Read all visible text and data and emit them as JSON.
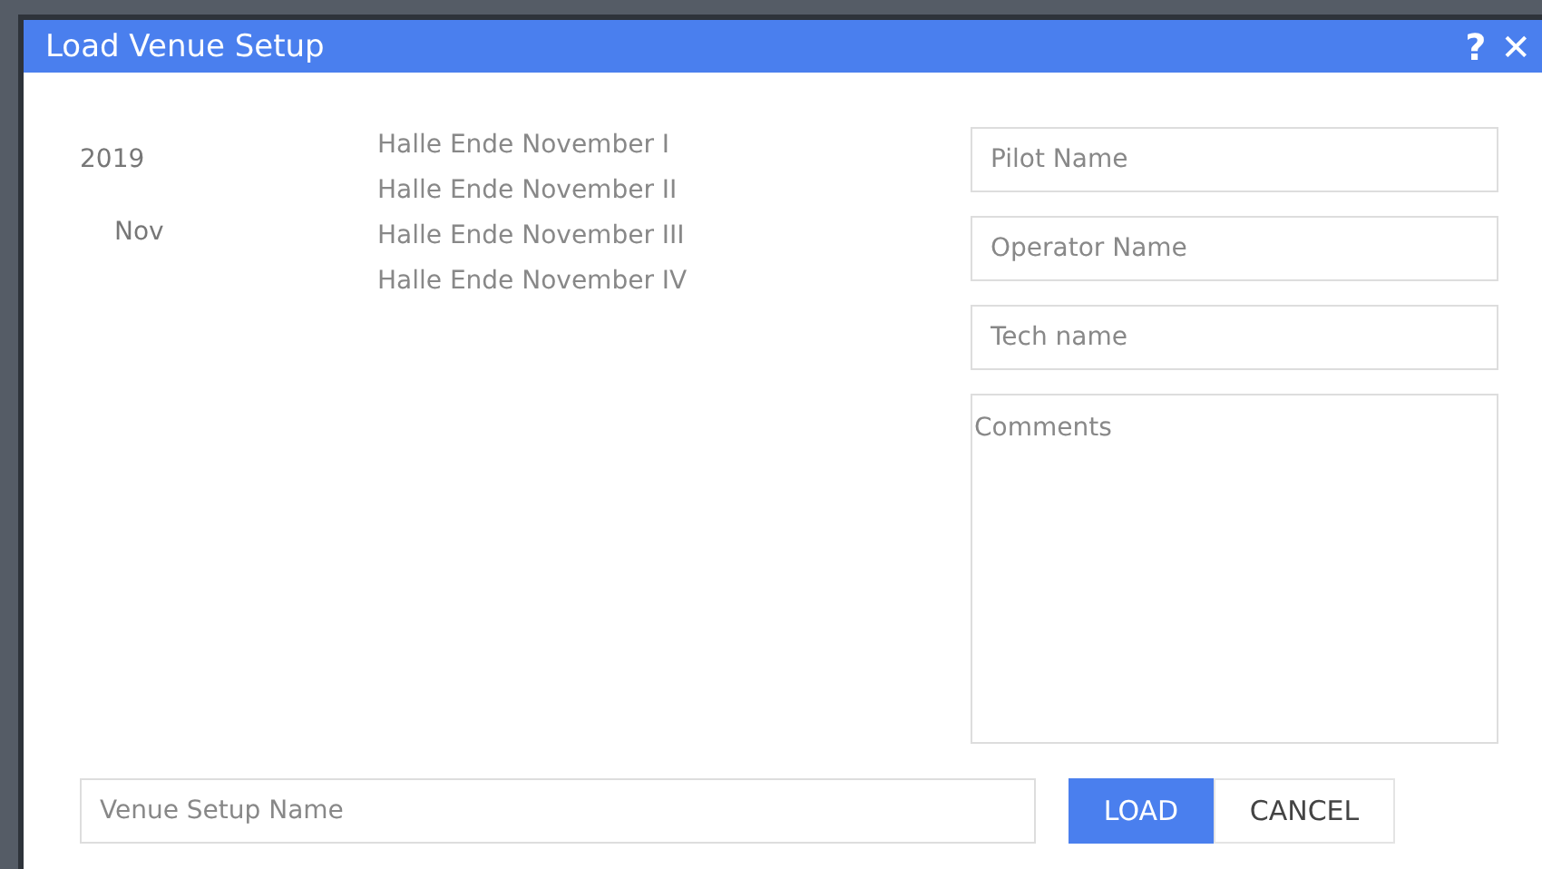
{
  "window": {
    "title": "Load Venue Setup",
    "help_glyph": "?",
    "close_glyph": "✕"
  },
  "tree": [
    {
      "label": "2019",
      "children": [
        {
          "label": "Nov"
        }
      ]
    }
  ],
  "venues": [
    "Halle Ende November I",
    "Halle Ende November II",
    "Halle Ende November III",
    "Halle Ende November IV"
  ],
  "fields": [
    {
      "placeholder": "Pilot Name"
    },
    {
      "placeholder": "Operator Name"
    },
    {
      "placeholder": "Tech name"
    }
  ],
  "comments": {
    "placeholder": "Comments"
  },
  "venue_setup_name": {
    "placeholder": "Venue Setup Name"
  },
  "buttons": [
    {
      "label": "LOAD",
      "kind": "primary"
    },
    {
      "label": "CANCEL",
      "kind": "secondary"
    }
  ]
}
